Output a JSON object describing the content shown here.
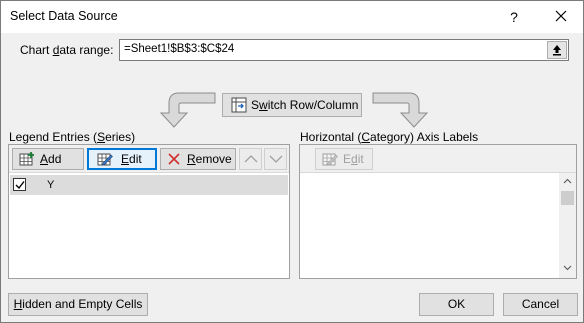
{
  "window": {
    "title": "Select Data Source",
    "help_glyph": "?"
  },
  "range": {
    "label_pre": "Chart ",
    "label_ul": "d",
    "label_post": "ata range:",
    "value": "=Sheet1!$B$3:$C$24"
  },
  "switch": {
    "label_ul": "w",
    "label_pre": "S",
    "label_post": "itch Row/Column"
  },
  "legend": {
    "label_pre": "Legend Entries (",
    "label_ul": "S",
    "label_post": "eries)",
    "add": {
      "ul": "A",
      "rest": "dd"
    },
    "edit": {
      "ul": "E",
      "rest": "dit"
    },
    "remove": {
      "ul": "R",
      "rest": "emove"
    },
    "series": [
      {
        "name": "Y",
        "checked": true
      }
    ]
  },
  "axis": {
    "label_pre": "Horizontal (",
    "label_ul": "C",
    "label_post": "ategory) Axis Labels",
    "edit": {
      "ul": "d",
      "pre": "E",
      "rest": "it"
    }
  },
  "footer": {
    "hidden": {
      "ul": "H",
      "rest": "idden and Empty Cells"
    },
    "ok": "OK",
    "cancel": "Cancel"
  },
  "colors": {
    "accent": "#0078d7",
    "arrow_fill": "#d9d9d9",
    "arrow_stroke": "#8c8c8c"
  }
}
